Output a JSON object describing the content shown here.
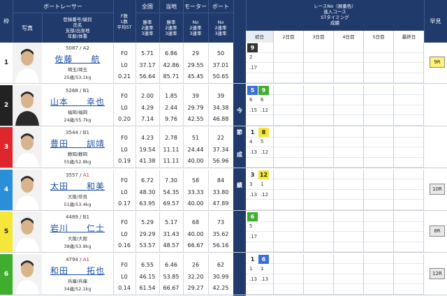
{
  "header": {
    "col_frame": "枠",
    "col_photo": "写真",
    "col_racer": "ボートレーサー",
    "col_racer_sub": [
      "登録番号/級別",
      "氏名",
      "支部/出身地",
      "年齢/体重"
    ],
    "col_f_l": [
      "F数",
      "L数",
      "平均ST"
    ],
    "col_national": "全国",
    "col_local": "当地",
    "col_motor": "モーター",
    "col_boat": "ボート",
    "col_sub_rates": [
      "勝率",
      "2連率",
      "3連率"
    ],
    "col_sub_motor": [
      "No",
      "2連率",
      "3連率"
    ],
    "col_results_title": [
      "レースNo（展番色）",
      "進入コース",
      "STタイミング",
      "成績"
    ],
    "days": [
      "初日",
      "2日目",
      "3日目",
      "4日目",
      "5日目",
      "最終日"
    ],
    "col_early": "早見",
    "side_label": [
      "今",
      "節",
      "成",
      "績"
    ]
  },
  "racers": [
    {
      "frame": "1",
      "frame_color": "#ffffff",
      "frame_text": "#222222",
      "reg": "5087",
      "class": "A2",
      "name": "佐藤　　航",
      "pref": "埼玉/埼玉",
      "age": "25歳/53.1kg",
      "f": "F0",
      "l": "L0",
      "avg_st": "0.21",
      "nat": [
        "5.71",
        "37.17",
        "56.64"
      ],
      "loc": [
        "6.86",
        "42.86",
        "85.71"
      ],
      "motor": [
        "29",
        "29.55",
        "45.45"
      ],
      "boat": [
        "50",
        "37.01",
        "50.65"
      ],
      "results": [
        {
          "race": "9",
          "race_bg": "#333333",
          "race_fg": "#ffffff",
          "course": "2",
          "st": ".17"
        }
      ],
      "early": "9R",
      "early_bg": "#fdf27a"
    },
    {
      "frame": "2",
      "frame_color": "#222222",
      "frame_text": "#ffffff",
      "reg": "5268",
      "class": "B1",
      "name": "山本　　幸也",
      "pref": "福岡/福岡",
      "age": "24歳/55.7kg",
      "f": "F0",
      "l": "L0",
      "avg_st": "0.20",
      "nat": [
        "2.00",
        "4.29",
        "7.14"
      ],
      "loc": [
        "1.85",
        "2.44",
        "9.76"
      ],
      "motor": [
        "39",
        "29.79",
        "42.55"
      ],
      "boat": [
        "39",
        "34.38",
        "46.88"
      ],
      "results": [
        {
          "race": "5",
          "race_bg": "#3b6fd8",
          "race_fg": "#ffffff",
          "race2": "9",
          "race2_bg": "#3fae2f",
          "course": "6",
          "st": ".15",
          "extra": "6",
          "extra2": ".12"
        }
      ],
      "early": "",
      "early_bg": ""
    },
    {
      "frame": "3",
      "frame_color": "#e0262d",
      "frame_text": "#ffffff",
      "reg": "3544",
      "class": "B1",
      "name": "豊田　　訓靖",
      "pref": "静岡/静岡",
      "age": "55歳/52.8kg",
      "f": "F0",
      "l": "L0",
      "avg_st": "0.19",
      "nat": [
        "4.23",
        "19.54",
        "41.38"
      ],
      "loc": [
        "2.78",
        "11.11",
        "11.11"
      ],
      "motor": [
        "51",
        "24.44",
        "40.00"
      ],
      "boat": [
        "22",
        "37.34",
        "56.96"
      ],
      "results": [
        {
          "race": "1",
          "race_bg": "#ffffff",
          "race_fg": "#222222",
          "race2": "8",
          "race2_bg": "#f5e63a",
          "course": "4",
          "st": ".13",
          "extra": "5",
          "extra2": ".12"
        }
      ],
      "early": "",
      "early_bg": ""
    },
    {
      "frame": "4",
      "frame_color": "#2b8fd8",
      "frame_text": "#ffffff",
      "reg": "3557",
      "class": "A1",
      "name": "太田　　和美",
      "pref": "大阪/奈良",
      "age": "51歳/53.4kg",
      "f": "F0",
      "l": "L0",
      "avg_st": "0.17",
      "nat": [
        "6.72",
        "48.30",
        "63.95"
      ],
      "loc": [
        "7.30",
        "54.35",
        "69.57"
      ],
      "motor": [
        "58",
        "33.33",
        "40.00"
      ],
      "boat": [
        "84",
        "33.80",
        "47.89"
      ],
      "results": [
        {
          "race": "3",
          "race_bg": "#ffffff",
          "race_fg": "#222222",
          "race2": "12",
          "race2_bg": "#f5e63a",
          "course": "3",
          "st": ".13",
          "extra": "1",
          "extra2": ".12"
        }
      ],
      "early": "10R",
      "early_bg": "#e8e8e8"
    },
    {
      "frame": "5",
      "frame_color": "#f5e63a",
      "frame_text": "#222222",
      "reg": "4489",
      "class": "B1",
      "name": "岩川　　仁士",
      "pref": "大阪/大阪",
      "age": "38歳/53.8kg",
      "f": "F0",
      "l": "L0",
      "avg_st": "0.16",
      "nat": [
        "5.29",
        "29.29",
        "53.57"
      ],
      "loc": [
        "5.17",
        "31.43",
        "48.57"
      ],
      "motor": [
        "68",
        "40.00",
        "66.67"
      ],
      "boat": [
        "73",
        "35.62",
        "56.16"
      ],
      "results": [
        {
          "race": "6",
          "race_bg": "#3fae2f",
          "race_fg": "#ffffff",
          "course": "5",
          "st": ".17"
        }
      ],
      "early": "8R",
      "early_bg": "#e8e8e8"
    },
    {
      "frame": "6",
      "frame_color": "#3fae2f",
      "frame_text": "#ffffff",
      "reg": "4794",
      "class": "A1",
      "name": "和田　　拓也",
      "pref": "兵庫/兵庫",
      "age": "34歳/52.1kg",
      "f": "F0",
      "l": "L0",
      "avg_st": "0.14",
      "nat": [
        "6.55",
        "46.15",
        "61.54"
      ],
      "loc": [
        "6.46",
        "53.85",
        "66.67"
      ],
      "motor": [
        "26",
        "32.20",
        "29.27"
      ],
      "boat": [
        "62",
        "30.99",
        "42.25"
      ],
      "results": [
        {
          "race": "1",
          "race_bg": "#ffffff",
          "race_fg": "#222222",
          "race2": "6",
          "race2_bg": "#3b6fd8",
          "course": "1",
          "st": ".13",
          "extra": "1",
          "extra2": ".13"
        }
      ],
      "early": "12R",
      "early_bg": "#e8e8e8"
    }
  ]
}
